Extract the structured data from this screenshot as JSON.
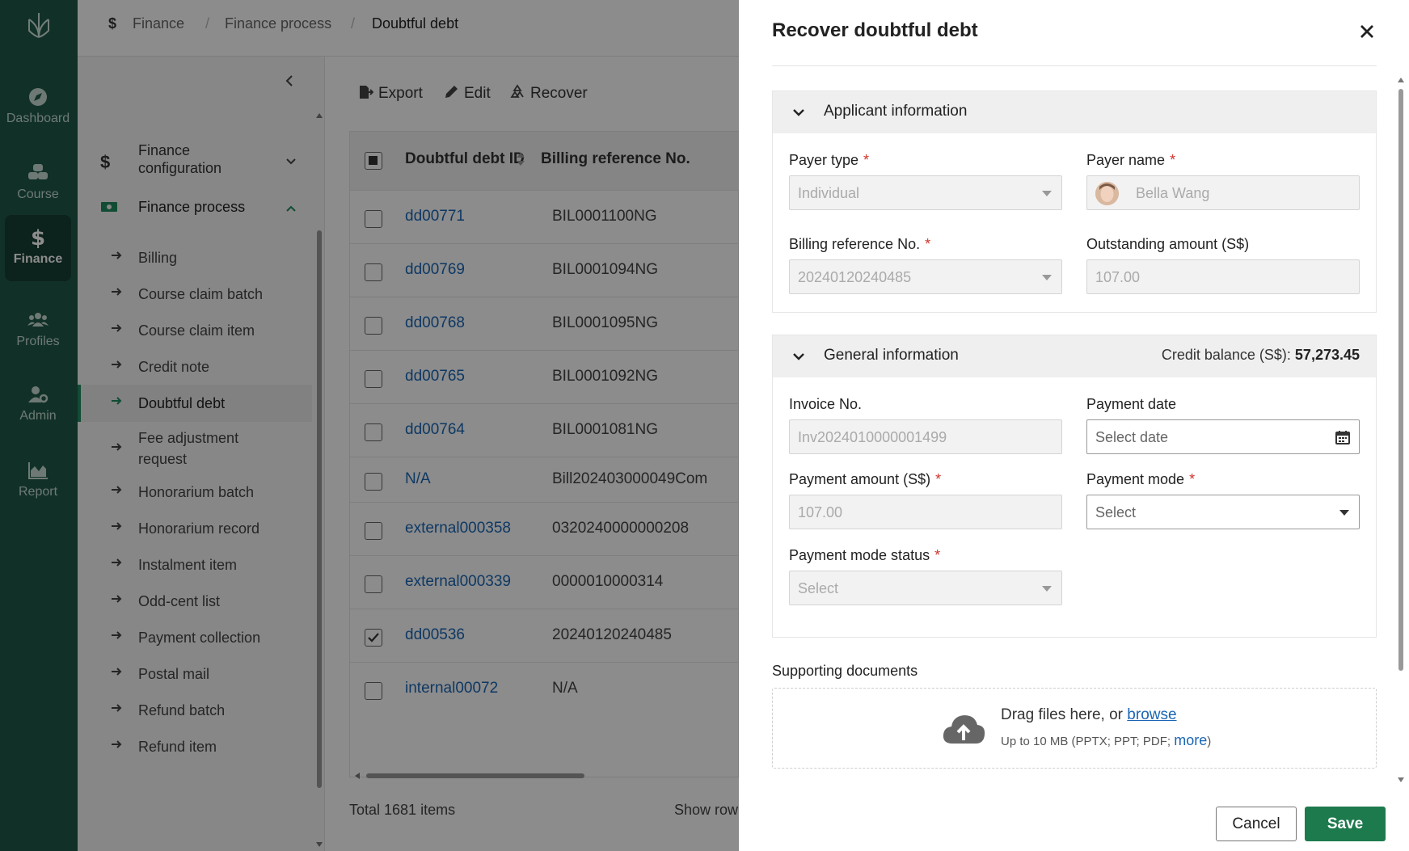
{
  "rail": {
    "items": [
      {
        "label": "Dashboard",
        "icon": "compass-icon"
      },
      {
        "label": "Course",
        "icon": "stack-icon"
      },
      {
        "label": "Finance",
        "icon": "dollar-icon"
      },
      {
        "label": "Profiles",
        "icon": "users-icon"
      },
      {
        "label": "Admin",
        "icon": "user-gear-icon"
      },
      {
        "label": "Report",
        "icon": "area-chart-icon"
      }
    ]
  },
  "breadcrumb": [
    "Finance",
    "Finance process",
    "Doubtful debt"
  ],
  "sidebar": {
    "sections": [
      {
        "label": "Finance configuration",
        "label_line1": "Finance",
        "label_line2": "configuration"
      },
      {
        "label": "Finance process"
      }
    ],
    "items": [
      {
        "label": "Billing"
      },
      {
        "label": "Course claim batch"
      },
      {
        "label": "Course claim item"
      },
      {
        "label": "Credit note"
      },
      {
        "label": "Doubtful debt"
      },
      {
        "label_line1": "Fee adjustment",
        "label_line2": "request"
      },
      {
        "label": "Honorarium batch"
      },
      {
        "label": "Honorarium record"
      },
      {
        "label": "Instalment item"
      },
      {
        "label": "Odd-cent list"
      },
      {
        "label": "Payment collection"
      },
      {
        "label": "Postal mail"
      },
      {
        "label": "Refund batch"
      },
      {
        "label": "Refund item"
      }
    ]
  },
  "toolbar": {
    "export": "Export",
    "edit": "Edit",
    "recover": "Recover"
  },
  "table": {
    "columns": [
      "Doubtful debt ID",
      "Billing reference No."
    ],
    "rows": [
      {
        "id": "dd00771",
        "ref": "BIL0001100NG",
        "checked": false
      },
      {
        "id": "dd00769",
        "ref": "BIL0001094NG",
        "checked": false
      },
      {
        "id": "dd00768",
        "ref": "BIL0001095NG",
        "checked": false
      },
      {
        "id": "dd00765",
        "ref": "BIL0001092NG",
        "checked": false
      },
      {
        "id": "dd00764",
        "ref": "BIL0001081NG",
        "checked": false
      },
      {
        "id": "N/A",
        "ref": "Bill202403000049Com",
        "checked": false
      },
      {
        "id": "external000358",
        "ref": "0320240000000208",
        "checked": false
      },
      {
        "id": "external000339",
        "ref": "0000010000314",
        "checked": false
      },
      {
        "id": "dd00536",
        "ref": "20240120240485",
        "checked": true
      },
      {
        "id": "internal00072",
        "ref": "N/A",
        "checked": false
      }
    ],
    "total": "Total 1681 items",
    "show_rows": "Show row"
  },
  "drawer": {
    "title": "Recover doubtful debt",
    "applicant": {
      "title": "Applicant information",
      "payer_type_label": "Payer type",
      "payer_type_value": "Individual",
      "payer_name_label": "Payer name",
      "payer_name_value": "Bella Wang",
      "billing_ref_label": "Billing reference No.",
      "billing_ref_value": "20240120240485",
      "outstanding_label": "Outstanding amount (S$)",
      "outstanding_value": "107.00"
    },
    "general": {
      "title": "General information",
      "credit_label": "Credit balance (S$):",
      "credit_value": "57,273.45",
      "invoice_label": "Invoice No.",
      "invoice_value": "Inv2024010000001499",
      "payment_date_label": "Payment date",
      "payment_date_placeholder": "Select date",
      "payment_amount_label": "Payment amount (S$)",
      "payment_amount_value": "107.00",
      "payment_mode_label": "Payment mode",
      "payment_mode_value": "Select",
      "payment_mode_status_label": "Payment mode status",
      "payment_mode_status_value": "Select"
    },
    "supporting": {
      "label": "Supporting documents",
      "drag_text": "Drag files here, or",
      "browse": "browse",
      "limit_text": "Up to 10 MB (PPTX; PPT; PDF;",
      "more": "more",
      "close_paren": ")"
    },
    "cancel": "Cancel",
    "save": "Save"
  },
  "colors": {
    "rail": "#1f5a4a",
    "accent": "#1d7a4d",
    "link": "#1a66b5",
    "required": "#d0342c"
  }
}
